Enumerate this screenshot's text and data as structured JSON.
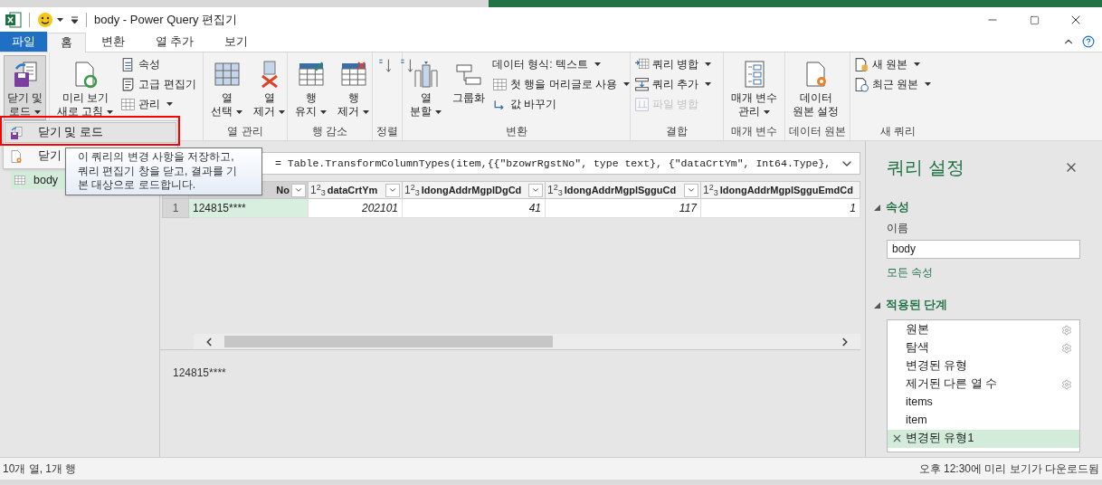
{
  "title_bar": {
    "title": "body - Power Query 편집기"
  },
  "ribbon_tabs": [
    {
      "label": "파일",
      "kind": "file",
      "selected": false
    },
    {
      "label": "홈",
      "kind": "tab",
      "selected": true
    },
    {
      "label": "변환",
      "kind": "tab",
      "selected": false
    },
    {
      "label": "열 추가",
      "kind": "tab",
      "selected": false
    },
    {
      "label": "보기",
      "kind": "tab",
      "selected": false
    }
  ],
  "ribbon_groups": [
    {
      "items": [
        {
          "kind": "large",
          "lines": [
            "닫기 및",
            "로드"
          ],
          "dropdown": true,
          "pressed": true
        }
      ]
    },
    {
      "items": [
        {
          "kind": "large",
          "lines": [
            "미리 보기",
            "새로 고침"
          ],
          "dropdown": true,
          "pressed": false
        },
        {
          "kind": "small",
          "label": "속성",
          "dropdown": false,
          "disabled": false
        },
        {
          "kind": "small",
          "label": "고급 편집기",
          "dropdown": false,
          "disabled": false
        },
        {
          "kind": "small",
          "label": "관리",
          "dropdown": true,
          "disabled": false
        }
      ]
    },
    {
      "label": "열 관리",
      "items": [
        {
          "kind": "large",
          "lines": [
            "열",
            "선택"
          ],
          "dropdown": true,
          "pressed": false
        },
        {
          "kind": "large",
          "lines": [
            "열",
            "제거"
          ],
          "dropdown": true,
          "pressed": false
        }
      ]
    },
    {
      "label": "행 감소",
      "items": [
        {
          "kind": "large",
          "lines": [
            "행",
            "유지"
          ],
          "dropdown": true,
          "pressed": false
        },
        {
          "kind": "large",
          "lines": [
            "행",
            "제거"
          ],
          "dropdown": true,
          "pressed": false
        }
      ]
    },
    {
      "label": "정렬",
      "items": [
        {
          "kind": "icon"
        },
        {
          "kind": "icon"
        }
      ]
    },
    {
      "label": "변환",
      "items": [
        {
          "kind": "large",
          "lines": [
            "열",
            "분할"
          ],
          "dropdown": true,
          "pressed": false
        },
        {
          "kind": "large",
          "lines": [
            "그룹화"
          ],
          "dropdown": false,
          "pressed": false
        },
        {
          "kind": "small",
          "label": "데이터 형식: 텍스트",
          "dropdown": true,
          "disabled": false
        },
        {
          "kind": "small",
          "label": "첫 행을 머리글로 사용",
          "dropdown": true,
          "disabled": false
        },
        {
          "kind": "small",
          "label": "값 바꾸기",
          "dropdown": false,
          "disabled": false
        }
      ]
    },
    {
      "label": "결합",
      "items": [
        {
          "kind": "small",
          "label": "쿼리 병합",
          "dropdown": true,
          "disabled": false
        },
        {
          "kind": "small",
          "label": "쿼리 추가",
          "dropdown": true,
          "disabled": false
        },
        {
          "kind": "small",
          "label": "파일 병합",
          "dropdown": false,
          "disabled": true
        }
      ]
    },
    {
      "label": "매개 변수",
      "items": [
        {
          "kind": "large",
          "lines": [
            "매개 변수",
            "관리"
          ],
          "dropdown": true,
          "pressed": false
        }
      ]
    },
    {
      "label": "데이터 원본",
      "items": [
        {
          "kind": "large",
          "lines": [
            "데이터",
            "원본 설정"
          ],
          "dropdown": false,
          "pressed": false
        }
      ]
    },
    {
      "label": "새 쿼리",
      "items": [
        {
          "kind": "small",
          "label": "새 원본",
          "dropdown": true,
          "disabled": false
        },
        {
          "kind": "small",
          "label": "최근 원본",
          "dropdown": true,
          "disabled": false
        }
      ]
    }
  ],
  "menu": {
    "items": [
      {
        "label": "닫기 및 로드",
        "selected": true
      },
      {
        "label": "닫기",
        "selected": false
      }
    ]
  },
  "tooltip": {
    "text": "이 쿼리의 변경 사항을 저장하고, 쿼리 편집기 창을 닫고, 결과를 기본 대상으로 로드합니다."
  },
  "queries": [
    {
      "label": "body",
      "selected": true
    }
  ],
  "formula": "= Table.TransformColumnTypes(item,{{\"bzowrRgstNo\", type text}, {\"dataCrtYm\", Int64.Type},",
  "table": {
    "columns": [
      {
        "header": "No",
        "selected": true
      },
      {
        "type_icon": "1$^{2}$$_{3}$",
        "header": "dataCrtYm",
        "selected": false
      },
      {
        "type_icon": "1$^{2}$$_{3}$",
        "header": "IdongAddrMgplDgCd",
        "selected": false
      },
      {
        "type_icon": "1$^{2}$$_{3}$",
        "header": "IdongAddrMgplSgguCd",
        "selected": false
      },
      {
        "type_icon": "1$^{2}$$_{3}$",
        "header": "IdongAddrMgplSgguEmdCd",
        "selected": false
      }
    ],
    "rows": [
      {
        "number": "1",
        "cells": [
          "124815****",
          "202101",
          "41",
          "117",
          "1"
        ]
      }
    ]
  },
  "preview": {
    "text": "124815****"
  },
  "query_settings": {
    "title": "쿼리 설정",
    "properties_heading": "속성",
    "name_label": "이름",
    "name_value": "body",
    "all_properties_link": "모든 속성",
    "steps_heading": "적용된 단계",
    "steps": [
      {
        "label": "원본",
        "settings": true,
        "selected": false
      },
      {
        "label": "탐색",
        "settings": true,
        "selected": false
      },
      {
        "label": "변경된 유형",
        "settings": false,
        "selected": false
      },
      {
        "label": "제거된 다른 열 수",
        "settings": true,
        "selected": false
      },
      {
        "label": "items",
        "settings": false,
        "selected": false
      },
      {
        "label": "item",
        "settings": false,
        "selected": false
      },
      {
        "label": "변경된 유형1",
        "settings": false,
        "selected": true
      }
    ]
  },
  "status_bar": {
    "left": "10개 열, 1개 행",
    "right": "오후 12:30에 미리 보기가 다운로드됨"
  }
}
